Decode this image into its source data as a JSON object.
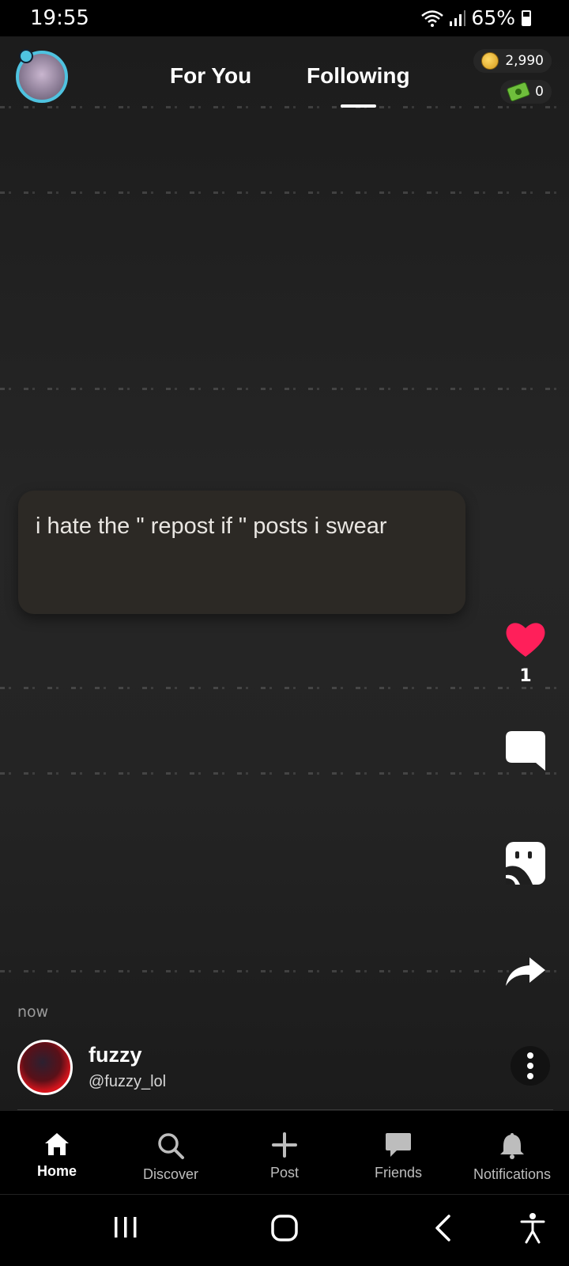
{
  "status_bar": {
    "time": "19:55",
    "battery": "65%"
  },
  "header": {
    "tabs": [
      {
        "label": "For You",
        "active": false
      },
      {
        "label": "Following",
        "active": true
      }
    ],
    "coins": "2,990",
    "cash": "0"
  },
  "post": {
    "text": "i hate the \" repost if \"  posts i swear",
    "likes": "1",
    "timestamp": "now",
    "author": {
      "name": "fuzzy",
      "handle": "@fuzzy_lol"
    }
  },
  "actions": [
    {
      "name": "like",
      "icon": "heart-icon",
      "color": "#ff1f5a"
    },
    {
      "name": "comment",
      "icon": "comment-icon"
    },
    {
      "name": "repost",
      "icon": "repost-icon"
    },
    {
      "name": "share",
      "icon": "share-icon"
    }
  ],
  "tab_bar": {
    "items": [
      {
        "label": "Home",
        "icon": "home-icon",
        "active": true
      },
      {
        "label": "Discover",
        "icon": "search-icon",
        "active": false
      },
      {
        "label": "Post",
        "icon": "plus-icon",
        "active": false
      },
      {
        "label": "Friends",
        "icon": "chat-icon",
        "active": false
      },
      {
        "label": "Notifications",
        "icon": "bell-icon",
        "active": false
      }
    ]
  },
  "colors": {
    "accent_heart": "#ff1f5a",
    "avatar_ring": "#4fc3e0",
    "background": "#000000"
  }
}
